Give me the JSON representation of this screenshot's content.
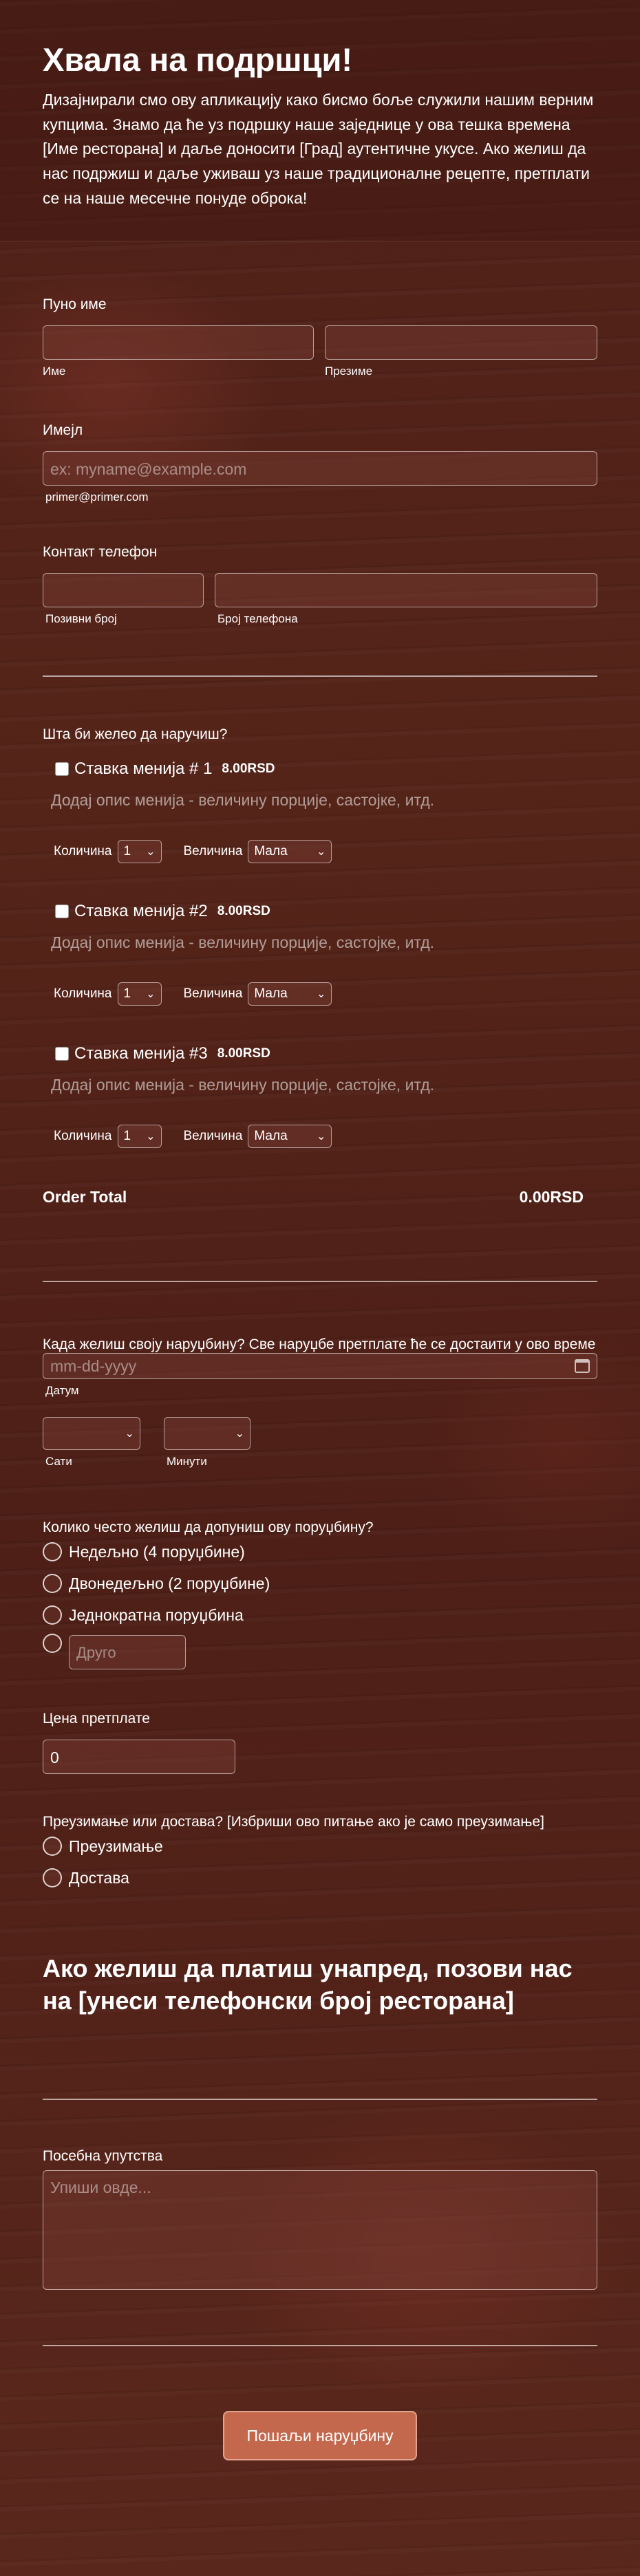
{
  "header": {
    "title": "Хвала на подршци!",
    "description": "Дизајнирали смо ову апликацију како бисмо боље служили нашим верним купцима. Знамо да ће уз подршку наше заједнице у ова тешка времена [Име ресторана] и даље доносити [Град] аутентичне укусе. Ако желиш да нас подржиш и даље уживаш уз наше традиционалне рецепте, претплати се на наше месечне понуде оброка!"
  },
  "full_name": {
    "label": "Пуно име",
    "first_sublabel": "Име",
    "last_sublabel": "Презиме"
  },
  "email": {
    "label": "Имејл",
    "placeholder": "ex: myname@example.com",
    "sublabel": "primer@primer.com"
  },
  "phone": {
    "label": "Контакт телефон",
    "area_sublabel": "Позивни број",
    "number_sublabel": "Број телефона"
  },
  "order": {
    "question": "Шта би желео да наручиш?",
    "items": [
      {
        "name": "Ставка менија # 1",
        "price": "8.00RSD",
        "desc": "Додај опис менија - величину порције, састојке, итд.",
        "qty_label": "Количина",
        "qty": "1",
        "size_label": "Величина",
        "size": "Мала"
      },
      {
        "name": "Ставка менија #2",
        "price": "8.00RSD",
        "desc": "Додај опис менија - величину порције, састојке, итд.",
        "qty_label": "Количина",
        "qty": "1",
        "size_label": "Величина",
        "size": "Мала"
      },
      {
        "name": "Ставка менија #3",
        "price": "8.00RSD",
        "desc": "Додај опис менија - величину порције, састојке, итд.",
        "qty_label": "Количина",
        "qty": "1",
        "size_label": "Величина",
        "size": "Мала"
      }
    ],
    "total_label": "Order Total",
    "total_value": "0.00RSD"
  },
  "delivery_time": {
    "label": "Када желиш своју наруџбину? Све наруџбе претплате ће се достаити у ово време",
    "date_placeholder": "mm-dd-yyyy",
    "date_sublabel": "Датум",
    "hours_sublabel": "Сати",
    "minutes_sublabel": "Минути"
  },
  "frequency": {
    "label": "Колико често желиш да допуниш ову поруџбину?",
    "options": [
      "Недељно (4 поруџбине)",
      "Двонедељно (2 поруџбине)",
      "Једнократна поруџбина"
    ],
    "other_placeholder": "Друго"
  },
  "subscription_price": {
    "label": "Цена претплате",
    "value": "0"
  },
  "pickup": {
    "label": "Преузимање или достава? [Избриши ово питање ако је само преузимање]",
    "options": [
      "Преузимање",
      "Достава"
    ]
  },
  "pay_ahead": {
    "text": "Ако желиш да платиш унапред, позови нас на [унеси телефонски број ресторана]"
  },
  "instructions": {
    "label": "Посебна упутства",
    "placeholder": "Упиши овде..."
  },
  "submit": {
    "label": "Пошаљи наруџбину"
  },
  "colors": {
    "background": "#4a1e16",
    "button": "#c4684d"
  }
}
